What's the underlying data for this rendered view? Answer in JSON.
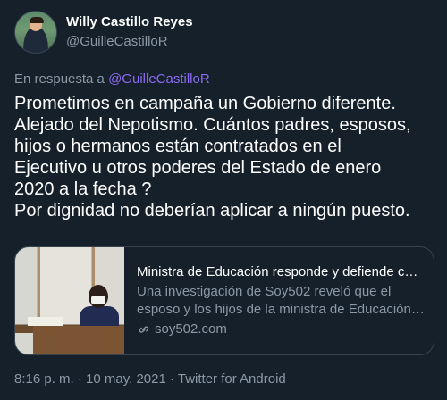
{
  "author": {
    "display_name": "Willy Castillo Reyes",
    "handle": "@GuilleCastilloR",
    "avatar_icon": "profile-photo"
  },
  "reply": {
    "prefix": "En respuesta a",
    "mention": "@GuilleCastilloR"
  },
  "tweet": {
    "lines": [
      "Prometimos en campaña un Gobierno diferente.",
      "Alejado del Nepotismo. Cuántos padres, esposos,",
      "hijos o hermanos están contratados en el",
      "Ejecutivo u otros poderes del Estado de enero",
      "2020 a la fecha ?",
      "Por dignidad no deberían aplicar a ningún puesto."
    ]
  },
  "card": {
    "title": "Ministra de Educación responde y defiende con...",
    "description_lines": [
      "Una investigación de Soy502 reveló que el",
      "esposo y los hijos de la ministra de Educación, ..."
    ],
    "domain": "soy502.com",
    "domain_icon": "link-icon"
  },
  "meta": {
    "timestamp": "8:16 p. m. · 10 may. 2021 · Twitter for Android"
  },
  "colors": {
    "background": "#15202b",
    "mention": "#8c6bf0",
    "secondary_text": "#8b98a5",
    "border": "#38444d"
  }
}
